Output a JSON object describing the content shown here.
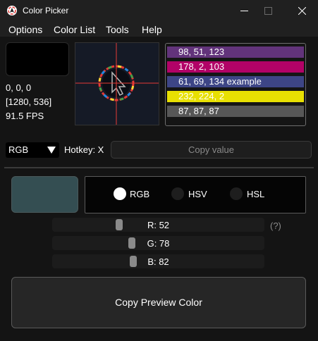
{
  "window": {
    "title": "Color Picker",
    "icon": "color-picker-app-icon",
    "controls": [
      "minimize-icon",
      "maximize-icon",
      "close-icon"
    ]
  },
  "menu": {
    "items": [
      "Options",
      "Color List",
      "Tools",
      "Help"
    ]
  },
  "picker": {
    "current_color": "#000000",
    "rgb_text": "0, 0, 0",
    "position_text": "[1280, 536]",
    "fps_text": "91.5 FPS"
  },
  "history": {
    "items": [
      {
        "label": "98, 51, 123",
        "color": "#62337b"
      },
      {
        "label": "178, 2, 103",
        "color": "#b20267"
      },
      {
        "label": "61, 69, 134 example",
        "color": "#3d4586"
      },
      {
        "label": "232, 224, 2",
        "color": "#e8e002"
      },
      {
        "label": "87, 87, 87",
        "color": "#575757"
      }
    ]
  },
  "controls": {
    "mode_value": "RGB",
    "hotkey_text": "Hotkey: X",
    "copy_value_label": "Copy value"
  },
  "editor": {
    "preview_color": "#344e52",
    "modes": [
      {
        "label": "RGB",
        "checked": true
      },
      {
        "label": "HSV",
        "checked": false
      },
      {
        "label": "HSL",
        "checked": false
      }
    ],
    "sliders": [
      {
        "label": "R: 52",
        "value": 52,
        "max": 255
      },
      {
        "label": "G: 78",
        "value": 78,
        "max": 255
      },
      {
        "label": "B: 82",
        "value": 82,
        "max": 255
      }
    ],
    "help_text": "(?)",
    "copy_preview_label": "Copy Preview Color"
  }
}
